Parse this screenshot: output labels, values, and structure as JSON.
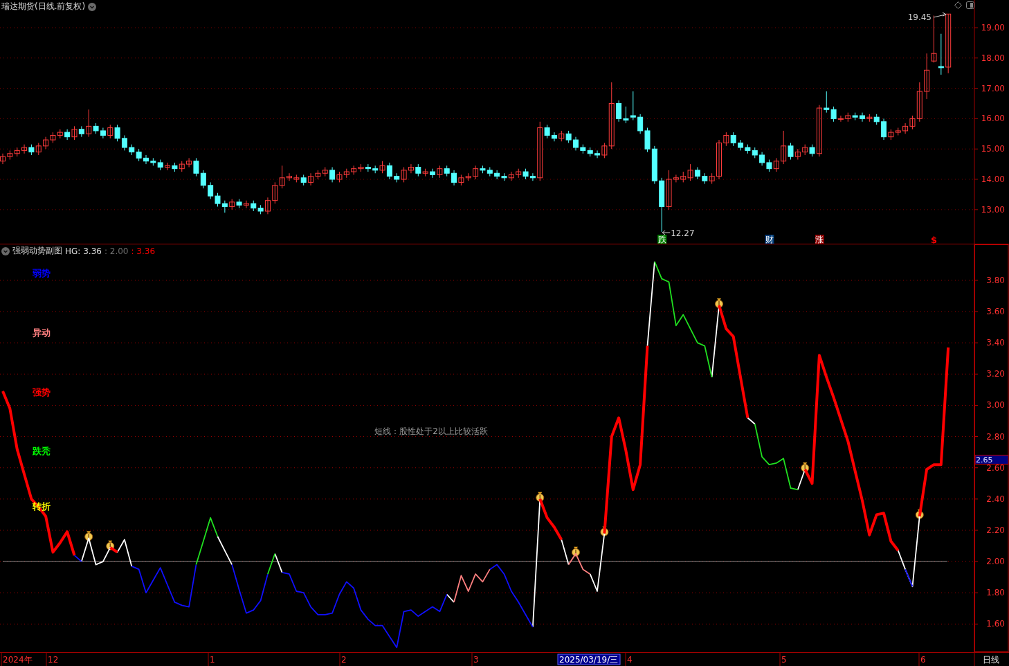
{
  "price_panel": {
    "title": "瑞达期货(日线.前复权)",
    "high_label": "19.45",
    "low_label": "12.27",
    "signals": [
      {
        "label": "跌",
        "kind": "badge",
        "color": "#008000"
      },
      {
        "label": "财",
        "kind": "badge",
        "color": "#003c78"
      },
      {
        "label": "涨",
        "kind": "badge",
        "color": "#8c0000"
      },
      {
        "label": "$",
        "kind": "glyph",
        "color": "#ff0000"
      }
    ],
    "chart_data": {
      "type": "candlestick",
      "grid": true,
      "ylim": [
        11.877,
        19.913
      ],
      "yticks": [
        {
          "value": 19,
          "label": "19.00"
        },
        {
          "value": 18,
          "label": "18.00"
        },
        {
          "value": 17,
          "label": "17.00"
        },
        {
          "value": 16,
          "label": "16.00"
        },
        {
          "value": 15,
          "label": "15.00"
        },
        {
          "value": 14,
          "label": "14.00"
        },
        {
          "value": 13,
          "label": "13.00"
        }
      ],
      "categories": [
        null,
        null,
        null,
        null,
        null,
        null,
        null,
        null,
        null,
        null,
        null,
        null,
        null,
        null,
        null,
        null,
        null,
        null,
        null,
        null,
        null,
        null,
        null,
        null,
        null,
        null,
        null,
        null,
        null,
        null,
        null,
        null,
        null,
        null,
        null,
        null,
        null,
        null,
        null,
        null,
        null,
        null,
        null,
        null,
        null,
        null,
        null,
        null,
        null,
        null,
        null,
        null,
        null,
        null,
        null,
        null,
        null,
        null,
        null,
        null,
        null,
        null,
        null,
        null,
        null,
        null,
        null,
        null,
        null,
        null,
        null,
        null,
        null,
        null,
        null,
        null,
        null,
        null,
        null,
        null,
        null,
        null,
        null,
        null,
        null,
        null,
        null,
        null,
        null,
        null,
        null,
        null,
        null,
        null,
        null,
        null,
        null,
        null,
        null,
        null,
        null,
        null,
        null,
        null,
        null,
        null,
        null,
        null,
        null,
        null,
        null,
        null,
        null,
        null,
        null,
        null,
        null,
        null,
        null,
        null,
        null,
        null,
        null,
        null,
        null,
        null,
        null,
        null,
        null,
        null,
        null,
        null,
        null
      ],
      "ohlc": [
        [
          14.6,
          14.85,
          14.5,
          14.75
        ],
        [
          14.75,
          14.95,
          14.65,
          14.85
        ],
        [
          14.85,
          15.05,
          14.75,
          14.95
        ],
        [
          14.95,
          15.15,
          14.85,
          15.05
        ],
        [
          15.05,
          15.15,
          14.8,
          14.9
        ],
        [
          14.9,
          15.2,
          14.8,
          15.1
        ],
        [
          15.1,
          15.4,
          15.0,
          15.3
        ],
        [
          15.3,
          15.55,
          15.2,
          15.45
        ],
        [
          15.45,
          15.65,
          15.35,
          15.55
        ],
        [
          15.55,
          15.65,
          15.3,
          15.4
        ],
        [
          15.4,
          15.75,
          15.3,
          15.65
        ],
        [
          15.65,
          15.75,
          15.4,
          15.5
        ],
        [
          15.5,
          16.3,
          15.4,
          15.75
        ],
        [
          15.75,
          15.85,
          15.5,
          15.6
        ],
        [
          15.6,
          15.7,
          15.35,
          15.45
        ],
        [
          15.45,
          15.8,
          15.35,
          15.7
        ],
        [
          15.7,
          15.8,
          15.25,
          15.35
        ],
        [
          15.35,
          15.45,
          14.95,
          15.05
        ],
        [
          15.05,
          15.15,
          14.8,
          14.9
        ],
        [
          14.9,
          15.0,
          14.6,
          14.7
        ],
        [
          14.7,
          14.8,
          14.5,
          14.6
        ],
        [
          14.6,
          14.7,
          14.45,
          14.55
        ],
        [
          14.55,
          14.65,
          14.3,
          14.4
        ],
        [
          14.4,
          14.55,
          14.3,
          14.45
        ],
        [
          14.45,
          14.55,
          14.25,
          14.35
        ],
        [
          14.35,
          14.6,
          14.25,
          14.5
        ],
        [
          14.5,
          14.7,
          14.4,
          14.6
        ],
        [
          14.6,
          14.7,
          14.1,
          14.2
        ],
        [
          14.2,
          14.3,
          13.7,
          13.8
        ],
        [
          13.8,
          13.9,
          13.35,
          13.45
        ],
        [
          13.45,
          13.55,
          13.1,
          13.2
        ],
        [
          13.2,
          13.3,
          12.9,
          13.1
        ],
        [
          13.1,
          13.35,
          13.0,
          13.25
        ],
        [
          13.25,
          13.35,
          13.05,
          13.15
        ],
        [
          13.15,
          13.3,
          13.05,
          13.2
        ],
        [
          13.2,
          13.3,
          12.95,
          13.05
        ],
        [
          13.05,
          13.15,
          12.85,
          12.95
        ],
        [
          12.95,
          13.4,
          12.85,
          13.3
        ],
        [
          13.3,
          13.9,
          13.2,
          13.8
        ],
        [
          13.8,
          14.45,
          13.7,
          14.05
        ],
        [
          14.05,
          14.2,
          13.95,
          14.1
        ],
        [
          14.0,
          14.15,
          13.9,
          14.05
        ],
        [
          14.05,
          14.15,
          13.8,
          13.9
        ],
        [
          13.9,
          14.2,
          13.8,
          14.1
        ],
        [
          14.1,
          14.3,
          14.0,
          14.2
        ],
        [
          14.2,
          14.4,
          14.1,
          14.3
        ],
        [
          14.3,
          14.4,
          13.9,
          14.0
        ],
        [
          14.0,
          14.25,
          13.9,
          14.15
        ],
        [
          14.15,
          14.35,
          14.05,
          14.25
        ],
        [
          14.25,
          14.45,
          14.15,
          14.35
        ],
        [
          14.35,
          14.5,
          14.25,
          14.4
        ],
        [
          14.4,
          14.5,
          14.25,
          14.35
        ],
        [
          14.35,
          14.45,
          14.2,
          14.3
        ],
        [
          14.3,
          14.6,
          14.2,
          14.45
        ],
        [
          14.45,
          14.55,
          14.0,
          14.1
        ],
        [
          14.1,
          14.2,
          13.9,
          14.0
        ],
        [
          14.0,
          14.4,
          13.9,
          14.3
        ],
        [
          14.3,
          14.5,
          14.2,
          14.4
        ],
        [
          14.4,
          14.5,
          14.1,
          14.2
        ],
        [
          14.2,
          14.35,
          14.1,
          14.25
        ],
        [
          14.25,
          14.35,
          14.05,
          14.15
        ],
        [
          14.15,
          14.45,
          14.05,
          14.35
        ],
        [
          14.35,
          14.45,
          14.1,
          14.2
        ],
        [
          14.2,
          14.3,
          13.8,
          13.9
        ],
        [
          13.9,
          14.15,
          13.8,
          14.05
        ],
        [
          14.05,
          14.2,
          13.95,
          14.1
        ],
        [
          14.1,
          14.45,
          14.0,
          14.35
        ],
        [
          14.35,
          14.45,
          14.2,
          14.3
        ],
        [
          14.3,
          14.4,
          14.1,
          14.2
        ],
        [
          14.2,
          14.3,
          14.0,
          14.1
        ],
        [
          14.1,
          14.2,
          13.95,
          14.05
        ],
        [
          14.05,
          14.25,
          13.95,
          14.15
        ],
        [
          14.15,
          14.35,
          14.05,
          14.25
        ],
        [
          14.25,
          14.35,
          14.0,
          14.1
        ],
        [
          14.1,
          14.2,
          13.95,
          14.05
        ],
        [
          14.05,
          15.9,
          13.95,
          15.7
        ],
        [
          15.7,
          15.8,
          15.35,
          15.45
        ],
        [
          15.45,
          15.55,
          15.25,
          15.35
        ],
        [
          15.35,
          15.6,
          15.25,
          15.5
        ],
        [
          15.5,
          15.6,
          15.2,
          15.3
        ],
        [
          15.3,
          15.4,
          14.95,
          15.05
        ],
        [
          15.05,
          15.15,
          14.85,
          14.95
        ],
        [
          14.95,
          15.05,
          14.75,
          14.85
        ],
        [
          14.85,
          14.95,
          14.7,
          14.8
        ],
        [
          14.8,
          15.2,
          14.7,
          15.1
        ],
        [
          15.1,
          17.2,
          15.0,
          16.5
        ],
        [
          16.5,
          16.6,
          15.9,
          16.0
        ],
        [
          16.0,
          16.4,
          15.85,
          15.95
        ],
        [
          16.1,
          16.9,
          15.95,
          16.05
        ],
        [
          16.05,
          16.15,
          15.5,
          15.6
        ],
        [
          15.6,
          15.7,
          14.9,
          15.0
        ],
        [
          15.0,
          15.1,
          13.85,
          13.95
        ],
        [
          13.95,
          14.05,
          12.27,
          13.1
        ],
        [
          13.1,
          14.3,
          13.0,
          14.0
        ],
        [
          14.0,
          14.15,
          13.9,
          14.05
        ],
        [
          14.0,
          14.25,
          13.9,
          14.1
        ],
        [
          14.05,
          14.5,
          13.95,
          14.3
        ],
        [
          14.3,
          14.4,
          14.0,
          14.1
        ],
        [
          14.1,
          14.2,
          13.85,
          13.95
        ],
        [
          13.95,
          14.2,
          13.85,
          14.1
        ],
        [
          14.1,
          15.3,
          14.0,
          15.2
        ],
        [
          15.2,
          15.55,
          15.1,
          15.45
        ],
        [
          15.45,
          15.55,
          15.1,
          15.2
        ],
        [
          15.2,
          15.3,
          14.95,
          15.05
        ],
        [
          15.05,
          15.15,
          14.85,
          14.95
        ],
        [
          14.95,
          15.05,
          14.7,
          14.8
        ],
        [
          14.8,
          14.9,
          14.45,
          14.55
        ],
        [
          14.55,
          14.65,
          14.25,
          14.35
        ],
        [
          14.35,
          14.7,
          14.25,
          14.6
        ],
        [
          14.6,
          15.6,
          14.5,
          15.1
        ],
        [
          15.1,
          15.2,
          14.65,
          14.75
        ],
        [
          14.75,
          15.0,
          14.65,
          14.9
        ],
        [
          14.9,
          15.15,
          14.8,
          15.05
        ],
        [
          15.05,
          15.15,
          14.75,
          14.85
        ],
        [
          14.85,
          16.45,
          14.75,
          16.35
        ],
        [
          16.35,
          16.9,
          16.2,
          16.3
        ],
        [
          16.3,
          16.4,
          15.9,
          16.0
        ],
        [
          16.0,
          16.1,
          15.9,
          16.0
        ],
        [
          16.0,
          16.2,
          15.9,
          16.1
        ],
        [
          16.1,
          16.2,
          15.95,
          16.05
        ],
        [
          16.1,
          16.2,
          15.9,
          16.0
        ],
        [
          16.0,
          16.15,
          15.9,
          16.05
        ],
        [
          16.05,
          16.15,
          15.8,
          15.9
        ],
        [
          15.9,
          16.0,
          15.3,
          15.4
        ],
        [
          15.4,
          15.65,
          15.3,
          15.55
        ],
        [
          15.55,
          15.7,
          15.45,
          15.6
        ],
        [
          15.6,
          15.85,
          15.5,
          15.75
        ],
        [
          15.75,
          16.1,
          15.65,
          16.0
        ],
        [
          16.0,
          17.2,
          15.9,
          16.9
        ],
        [
          16.9,
          18.15,
          16.65,
          17.6
        ],
        [
          17.9,
          19.4,
          17.85,
          18.15
        ],
        [
          17.72,
          18.8,
          17.45,
          17.68
        ],
        [
          17.7,
          19.45,
          17.5,
          19.45
        ]
      ]
    }
  },
  "indicator_panel": {
    "name": "强弱动势副图",
    "values": [
      {
        "text": "HG: 3.36",
        "color": "#e0e0e0"
      },
      {
        "text": ": 2.00",
        "color": "#707070"
      },
      {
        "text": ": 3.36",
        "color": "#ff0000"
      }
    ],
    "zone_labels": [
      {
        "text": "弱势",
        "color": "#0000ff"
      },
      {
        "text": "异动",
        "color": "#ff8080"
      },
      {
        "text": "强势",
        "color": "#ff0000"
      },
      {
        "text": "跌秃",
        "color": "#00ff00"
      },
      {
        "text": "转折",
        "color": "#ffff00"
      }
    ],
    "note": "短线：股性处于2以上比较活跃",
    "cursor_value": "2.65",
    "chart_data": {
      "type": "line",
      "grid": true,
      "ylim": [
        1.42,
        4.03
      ],
      "yticks": [
        {
          "value": 1.6,
          "label": "1.60"
        },
        {
          "value": 1.8,
          "label": "1.80"
        },
        {
          "value": 2.0,
          "label": "2.00"
        },
        {
          "value": 2.2,
          "label": "2.20"
        },
        {
          "value": 2.4,
          "label": "2.40"
        },
        {
          "value": 2.6,
          "label": "2.60"
        },
        {
          "value": 2.8,
          "label": "2.80"
        },
        {
          "value": 3.0,
          "label": "3.00"
        },
        {
          "value": 3.2,
          "label": "3.20"
        },
        {
          "value": 3.4,
          "label": "3.40"
        },
        {
          "value": 3.6,
          "label": "3.60"
        },
        {
          "value": 3.8,
          "label": "3.80"
        }
      ],
      "ref_lines": [
        {
          "axis": "y",
          "value": 2.0
        }
      ],
      "categories": [
        null,
        null,
        null,
        null,
        null,
        null,
        null,
        null,
        null,
        null,
        null,
        null,
        null,
        null,
        null,
        null,
        null,
        null,
        null,
        null,
        null,
        null,
        null,
        null,
        null,
        null,
        null,
        null,
        null,
        null,
        null,
        null,
        null,
        null,
        null,
        null,
        null,
        null,
        null,
        null,
        null,
        null,
        null,
        null,
        null,
        null,
        null,
        null,
        null,
        null,
        null,
        null,
        null,
        null,
        null,
        null,
        null,
        null,
        null,
        null,
        null,
        null,
        null,
        null,
        null,
        null,
        null,
        null,
        null,
        null,
        null,
        null,
        null,
        null,
        null,
        null,
        null,
        null,
        null,
        null,
        null,
        null,
        null,
        null,
        null,
        null,
        null,
        null,
        null,
        null,
        null,
        null,
        null,
        null,
        null,
        null,
        null,
        null,
        null,
        null,
        null,
        null,
        null,
        null,
        null,
        null,
        null,
        null,
        null,
        null,
        null,
        null,
        null,
        null,
        null,
        null,
        null,
        null,
        null,
        null,
        null,
        null,
        null,
        null,
        null,
        null,
        null,
        null,
        null,
        null,
        null,
        null,
        null
      ],
      "series": [
        {
          "color": "#ffffff",
          "values": [
            null,
            null,
            null,
            null,
            null,
            null,
            null,
            null,
            null,
            null,
            null,
            2.0,
            2.15,
            1.98,
            2.0,
            2.09,
            2.06,
            2.14,
            1.97,
            null,
            null,
            null,
            null,
            null,
            null,
            null,
            null,
            null,
            null,
            null,
            2.16,
            2.07,
            1.98,
            null,
            null,
            null,
            null,
            null,
            2.05,
            1.93,
            null,
            null,
            null,
            null,
            null,
            null,
            null,
            null,
            null,
            null,
            null,
            null,
            null,
            null,
            null,
            null,
            null,
            null,
            null,
            null,
            null,
            null,
            1.79,
            1.74,
            null,
            null,
            null,
            null,
            null,
            null,
            null,
            null,
            null,
            null,
            1.58,
            2.4,
            null,
            null,
            2.14,
            1.98,
            null,
            null,
            1.92,
            1.81,
            2.18,
            null,
            null,
            null,
            null,
            null,
            3.38,
            3.92,
            null,
            null,
            null,
            null,
            null,
            null,
            null,
            3.18,
            3.64,
            null,
            null,
            null,
            2.92,
            2.88,
            null,
            null,
            null,
            null,
            null,
            2.46,
            2.59,
            null,
            null,
            null,
            null,
            null,
            null,
            null,
            null,
            null,
            null,
            null,
            null,
            2.07,
            1.95,
            1.84,
            2.29,
            null,
            null,
            null,
            null
          ]
        },
        {
          "color": "#1010ff",
          "values": [
            null,
            null,
            null,
            null,
            null,
            null,
            null,
            null,
            null,
            null,
            2.04,
            2.0,
            null,
            null,
            null,
            null,
            null,
            null,
            1.97,
            1.95,
            1.8,
            1.88,
            1.96,
            1.85,
            1.74,
            1.72,
            1.71,
            1.98,
            null,
            null,
            null,
            null,
            1.98,
            1.82,
            1.67,
            1.69,
            1.75,
            1.92,
            null,
            1.93,
            1.92,
            1.81,
            1.8,
            1.71,
            1.66,
            1.66,
            1.67,
            1.79,
            1.87,
            1.83,
            1.69,
            1.63,
            1.59,
            1.59,
            1.52,
            1.45,
            1.68,
            1.69,
            1.65,
            1.68,
            1.71,
            1.68,
            1.79,
            null,
            null,
            null,
            null,
            null,
            1.95,
            1.98,
            1.92,
            1.81,
            1.74,
            1.66,
            1.58,
            null,
            null,
            null,
            null,
            null,
            null,
            null,
            null,
            null,
            null,
            null,
            null,
            null,
            null,
            null,
            null,
            null,
            null,
            null,
            null,
            null,
            null,
            null,
            null,
            null,
            null,
            null,
            null,
            null,
            null,
            null,
            null,
            null,
            null,
            null,
            null,
            null,
            null,
            null,
            null,
            null,
            null,
            null,
            null,
            null,
            null,
            null,
            null,
            null,
            null,
            null,
            1.95,
            1.84,
            null,
            null,
            null,
            null,
            null
          ]
        },
        {
          "color": "#20e020",
          "values": [
            null,
            null,
            null,
            null,
            null,
            null,
            null,
            null,
            null,
            null,
            null,
            null,
            null,
            null,
            null,
            null,
            null,
            null,
            null,
            null,
            null,
            null,
            null,
            null,
            null,
            null,
            null,
            1.98,
            2.13,
            2.28,
            2.16,
            null,
            null,
            null,
            null,
            null,
            null,
            1.92,
            2.05,
            null,
            null,
            null,
            null,
            null,
            null,
            null,
            null,
            null,
            null,
            null,
            null,
            null,
            null,
            null,
            null,
            null,
            null,
            null,
            null,
            null,
            null,
            null,
            null,
            null,
            null,
            null,
            null,
            null,
            null,
            null,
            null,
            null,
            null,
            null,
            null,
            null,
            null,
            null,
            null,
            null,
            null,
            null,
            null,
            null,
            null,
            null,
            null,
            null,
            null,
            null,
            null,
            3.92,
            3.81,
            3.79,
            3.51,
            3.58,
            3.49,
            3.4,
            3.38,
            3.18,
            null,
            null,
            null,
            null,
            null,
            2.88,
            2.67,
            2.62,
            2.63,
            2.66,
            2.47,
            2.46,
            null,
            null,
            null,
            null,
            null,
            null,
            null,
            null,
            null,
            null,
            null,
            null,
            null,
            null,
            null,
            null,
            null,
            null,
            null,
            null,
            null
          ]
        },
        {
          "color": "#ff8080",
          "values": [
            null,
            null,
            null,
            null,
            null,
            null,
            null,
            null,
            null,
            null,
            null,
            null,
            null,
            null,
            null,
            null,
            null,
            null,
            null,
            null,
            null,
            null,
            null,
            null,
            null,
            null,
            null,
            null,
            null,
            null,
            null,
            null,
            null,
            null,
            null,
            null,
            null,
            null,
            null,
            null,
            null,
            null,
            null,
            null,
            null,
            null,
            null,
            null,
            null,
            null,
            null,
            null,
            null,
            null,
            null,
            null,
            null,
            null,
            null,
            null,
            null,
            null,
            null,
            1.74,
            1.91,
            1.81,
            1.92,
            1.87,
            1.95,
            null,
            null,
            null,
            null,
            null,
            null,
            null,
            null,
            null,
            null,
            1.98,
            2.05,
            1.95,
            1.92,
            null,
            null,
            null,
            null,
            null,
            null,
            null,
            null,
            null,
            null,
            null,
            null,
            null,
            null,
            null,
            null,
            null,
            null,
            null,
            null,
            null,
            null,
            null,
            null,
            null,
            null,
            null,
            null,
            null,
            null,
            null,
            null,
            null,
            null,
            null,
            null,
            null,
            null,
            null,
            null,
            null,
            null,
            null,
            null,
            null,
            null,
            null,
            null,
            null,
            null
          ]
        },
        {
          "color": "#ff0000",
          "values": [
            3.09,
            2.98,
            2.72,
            2.56,
            2.4,
            2.35,
            2.29,
            2.06,
            2.12,
            2.19,
            2.04,
            null,
            null,
            null,
            null,
            2.09,
            2.06,
            null,
            null,
            null,
            null,
            null,
            null,
            null,
            null,
            null,
            null,
            null,
            null,
            null,
            null,
            null,
            null,
            null,
            null,
            null,
            null,
            null,
            null,
            null,
            null,
            null,
            null,
            null,
            null,
            null,
            null,
            null,
            null,
            null,
            null,
            null,
            null,
            null,
            null,
            null,
            null,
            null,
            null,
            null,
            null,
            null,
            null,
            null,
            null,
            null,
            null,
            null,
            null,
            null,
            null,
            null,
            null,
            null,
            null,
            2.4,
            2.28,
            2.22,
            2.14,
            null,
            null,
            null,
            null,
            null,
            2.18,
            2.8,
            2.92,
            2.71,
            2.46,
            2.62,
            3.38,
            null,
            null,
            null,
            null,
            null,
            null,
            null,
            null,
            null,
            3.64,
            3.49,
            3.44,
            3.18,
            2.92,
            null,
            null,
            null,
            null,
            null,
            null,
            null,
            2.59,
            2.5,
            3.32,
            3.18,
            3.05,
            2.91,
            2.77,
            2.58,
            2.39,
            2.17,
            2.3,
            2.31,
            2.13,
            2.07,
            null,
            null,
            2.29,
            2.59,
            2.62,
            2.62,
            3.37
          ]
        }
      ]
    },
    "signals": [
      {
        "kind": "money-bag"
      },
      {
        "kind": "money-bag"
      },
      {
        "kind": "money-bag"
      },
      {
        "kind": "money-bag"
      },
      {
        "kind": "money-bag"
      },
      {
        "kind": "money-bag"
      },
      {
        "kind": "money-bag"
      },
      {
        "kind": "money-bag"
      }
    ]
  },
  "time_axis": {
    "labels": [
      "2024年",
      "12",
      "1",
      "2",
      "3",
      "4",
      "5",
      "6"
    ],
    "cursor_date": "2025/03/19/三",
    "period": "日线"
  }
}
